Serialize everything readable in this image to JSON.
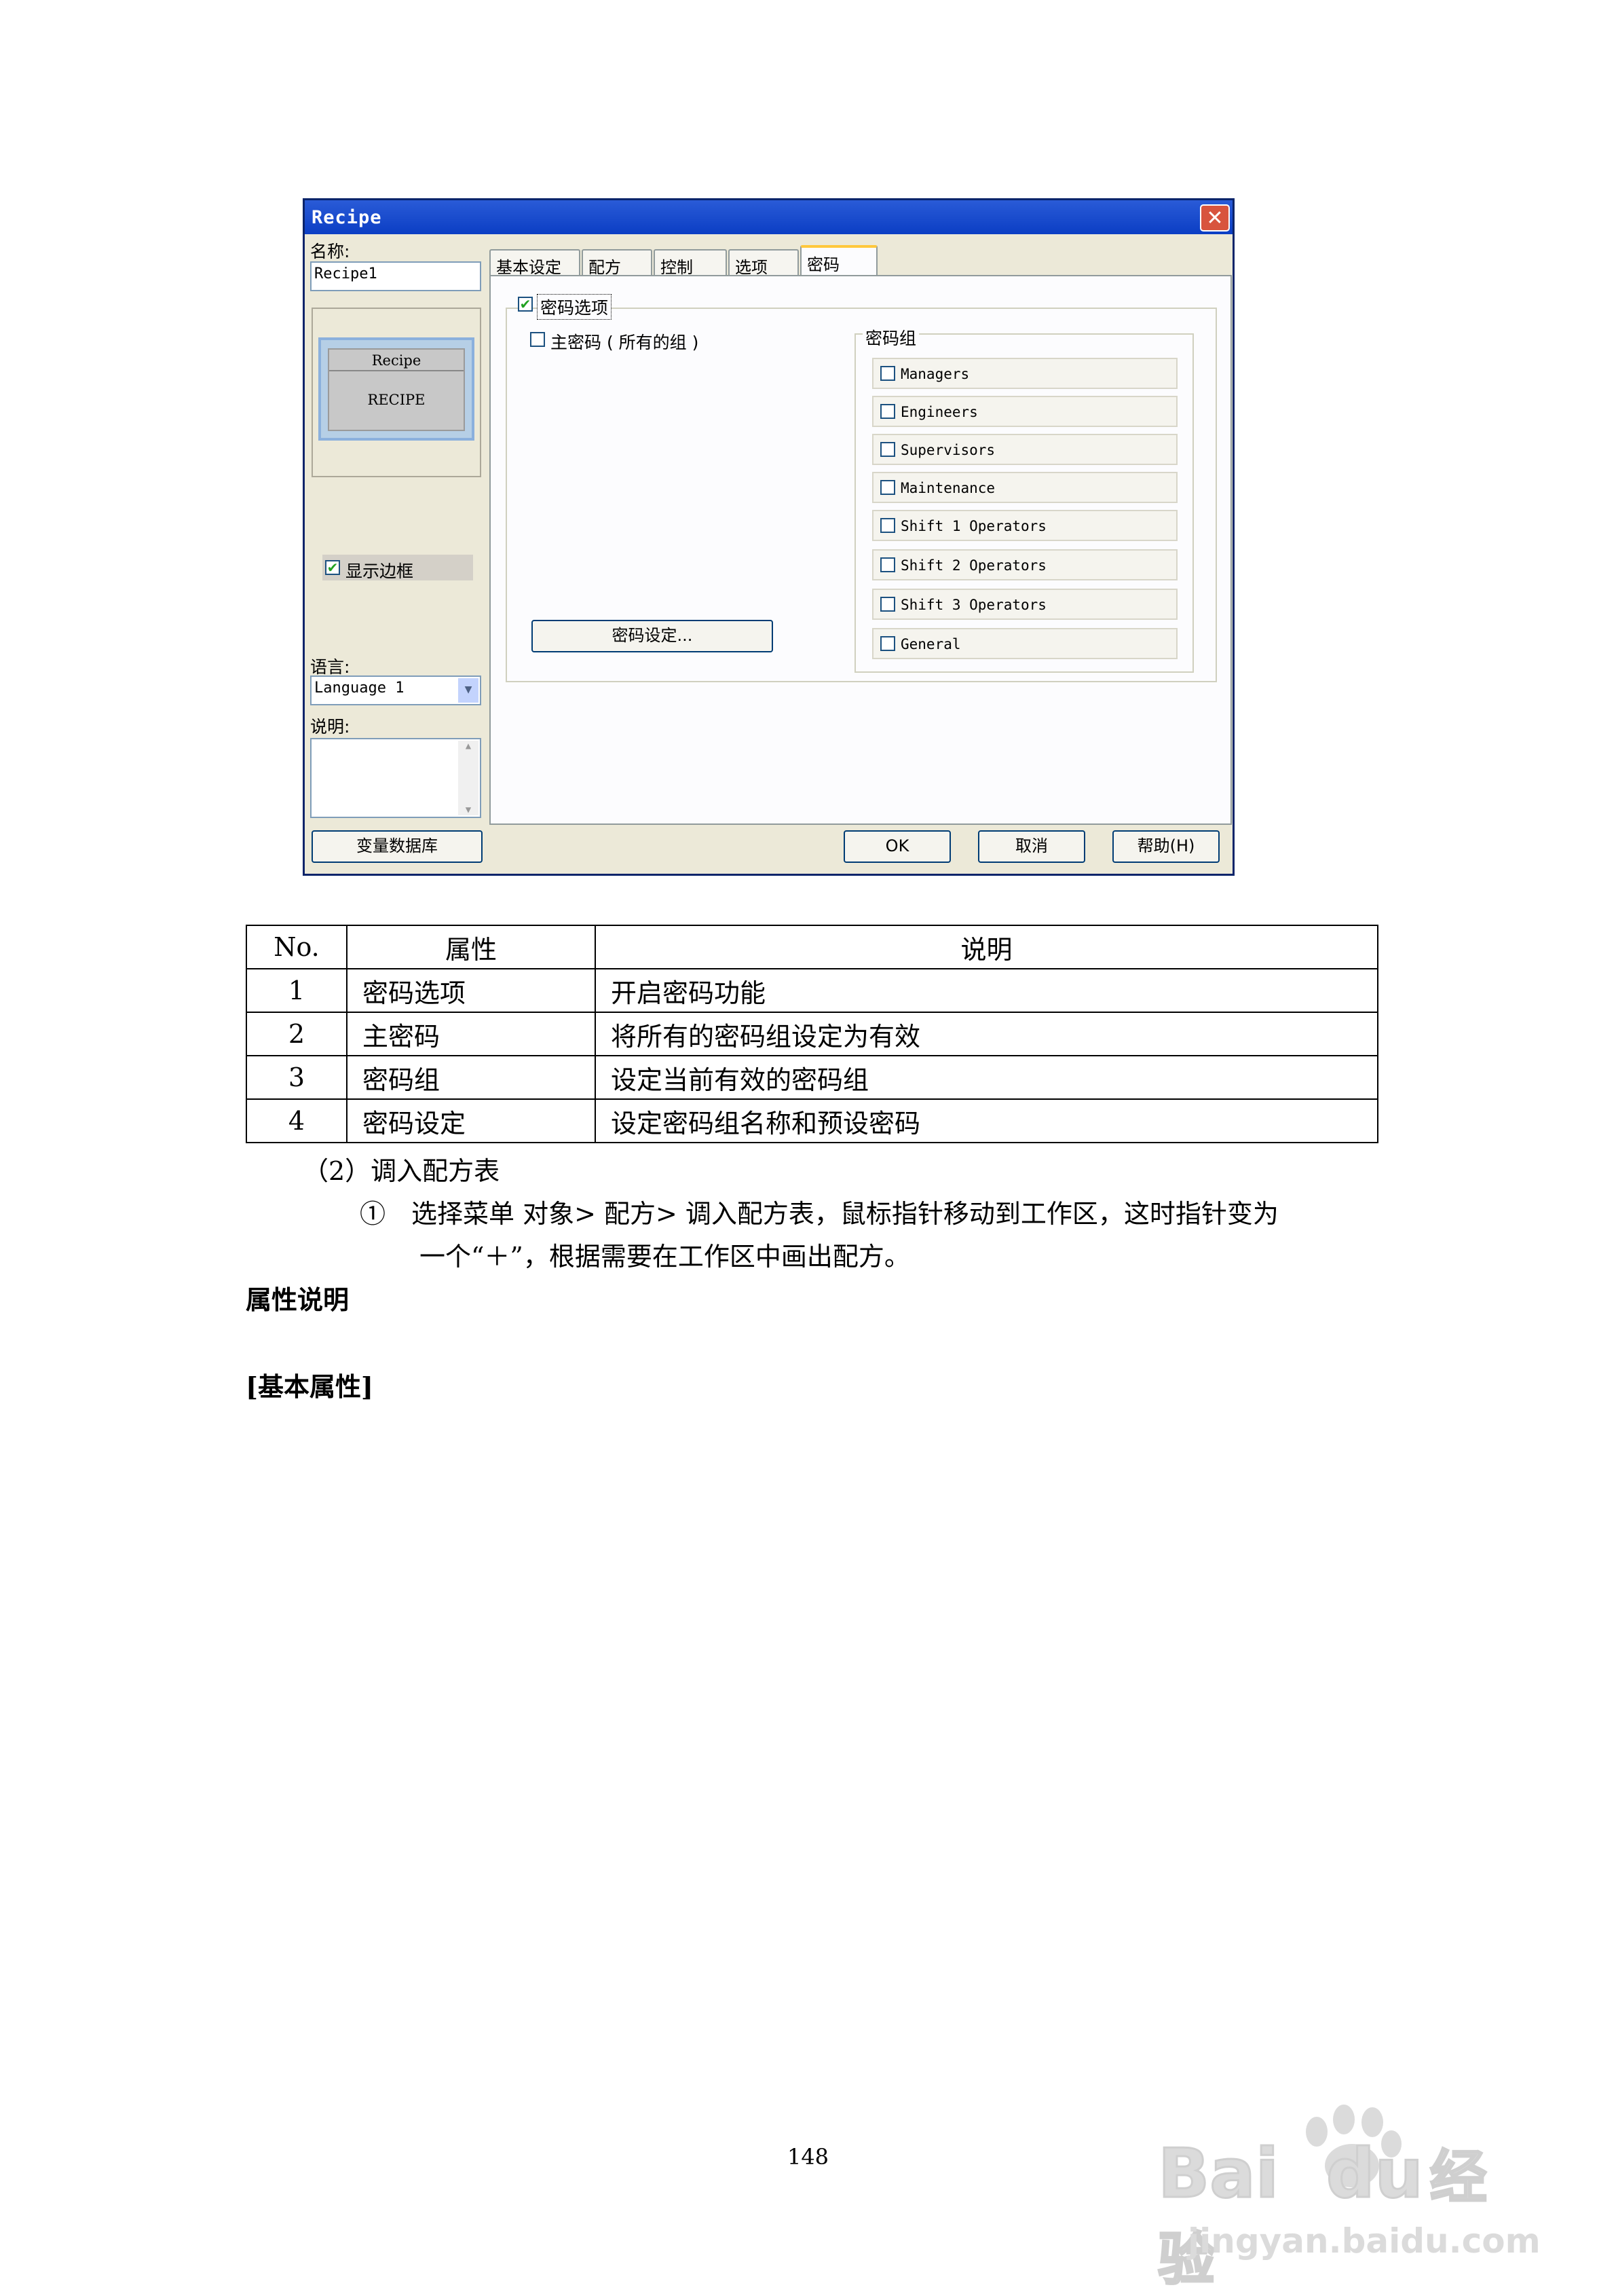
{
  "dialog": {
    "title": "Recipe",
    "close_label": "✕",
    "name_label": "名称:",
    "name_value": "Recipe1",
    "preview_title": "Recipe",
    "preview_text": "RECIPE",
    "show_border_label": "显示边框",
    "language_label": "语言:",
    "language_value": "Language 1",
    "description_label": "说明:",
    "tabs": [
      "基本设定",
      "配方",
      "控制",
      "选项",
      "密码"
    ],
    "active_tab": "密码",
    "password_option_label": "密码选项",
    "master_password_label": "主密码 ( 所有的组 )",
    "password_group_label": "密码组",
    "groups": [
      "Managers",
      "Engineers",
      "Supervisors",
      "Maintenance",
      "Shift 1 Operators",
      "Shift 2 Operators",
      "Shift 3 Operators",
      "General"
    ],
    "password_settings_button": "密码设定...",
    "variable_db_button": "变量数据库",
    "ok_button": "OK",
    "cancel_button": "取消",
    "help_button": "帮助(H)"
  },
  "table": {
    "headers": [
      "No.",
      "属性",
      "说明"
    ],
    "rows": [
      [
        "1",
        "密码选项",
        "开启密码功能"
      ],
      [
        "2",
        "主密码",
        "将所有的密码组设定为有效"
      ],
      [
        "3",
        "密码组",
        "设定当前有效的密码组"
      ],
      [
        "4",
        "密码设定",
        "设定密码组名称和预设密码"
      ]
    ]
  },
  "text": {
    "step_heading": "（2）调入配方表",
    "step1_line1": "①　选择菜单 对象> 配方> 调入配方表，鼠标指针移动到工作区，这时指针变为",
    "step1_line2": "一个“＋”，根据需要在工作区中画出配方。",
    "section_title": "属性说明",
    "subsection_title": "[基本属性]",
    "page_number": "148"
  },
  "watermark": {
    "brand": "Bai",
    "brand2": "du",
    "brand_cn": "经验",
    "url": "jingyan.baidu.com"
  }
}
